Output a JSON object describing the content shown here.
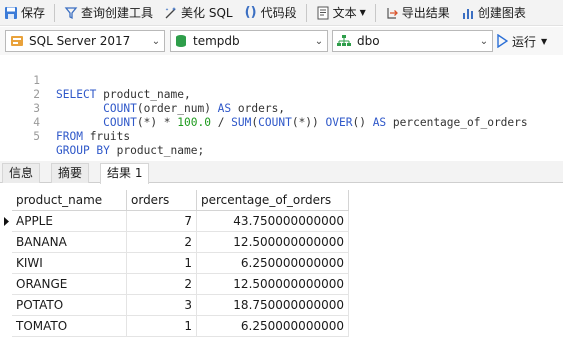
{
  "toolbar": {
    "save": "保存",
    "query_builder": "查询创建工具",
    "beautify": "美化 SQL",
    "snippet": "代码段",
    "text": "文本",
    "export": "导出结果",
    "create_chart": "创建图表"
  },
  "selectors": {
    "server": "SQL Server 2017",
    "database": "tempdb",
    "schema": "dbo",
    "run": "运行"
  },
  "editor": {
    "line_numbers": [
      "1",
      "2",
      "3",
      "4",
      "5"
    ]
  },
  "result_tabs": [
    "信息",
    "摘要",
    "结果 1"
  ],
  "grid": {
    "columns": [
      "product_name",
      "orders",
      "percentage_of_orders"
    ],
    "rows": [
      [
        "APPLE",
        "7",
        "43.750000000000"
      ],
      [
        "BANANA",
        "2",
        "12.500000000000"
      ],
      [
        "KIWI",
        "1",
        "6.250000000000"
      ],
      [
        "ORANGE",
        "2",
        "12.500000000000"
      ],
      [
        "POTATO",
        "3",
        "18.750000000000"
      ],
      [
        "TOMATO",
        "1",
        "6.250000000000"
      ]
    ]
  },
  "colors": {
    "keyword": "#2f58c9",
    "number": "#1c9a1c",
    "run_icon": "#2b6fd6"
  },
  "icons": [
    "save-icon",
    "query-builder-icon",
    "beautify-icon",
    "snippet-icon",
    "text-icon",
    "export-icon",
    "chart-icon",
    "server-icon",
    "database-icon",
    "schema-icon",
    "run-icon"
  ]
}
